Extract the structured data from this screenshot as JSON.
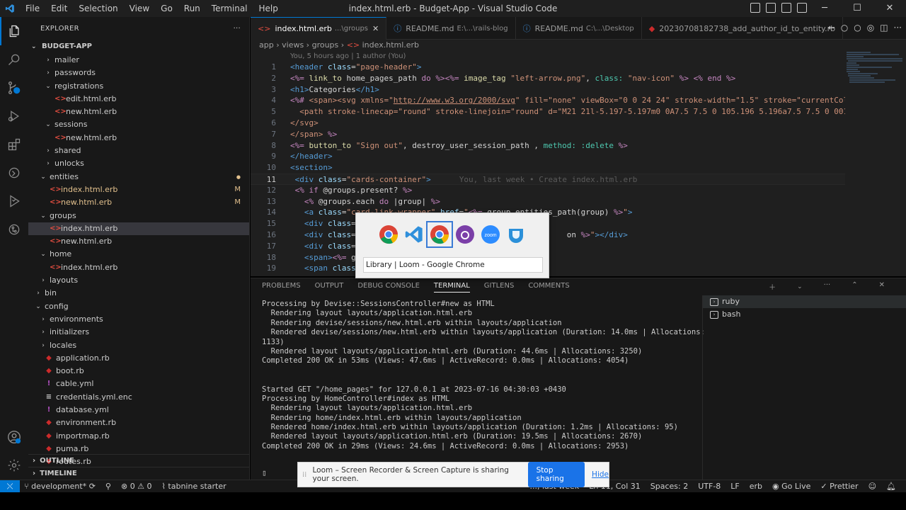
{
  "titlebar": {
    "menu": [
      "File",
      "Edit",
      "Selection",
      "View",
      "Go",
      "Run",
      "Terminal",
      "Help"
    ],
    "title": "index.html.erb - Budget-App - Visual Studio Code"
  },
  "activity_icons": [
    "files-icon",
    "search-icon",
    "source-control-icon",
    "run-debug-icon",
    "extensions-icon",
    "remote-icon",
    "testing-icon",
    "gitlens-icon"
  ],
  "sidebar": {
    "header": "EXPLORER",
    "more": "···",
    "project": "BUDGET-APP",
    "tree": [
      {
        "label": "mailer",
        "indent": 2,
        "type": "folder",
        "open": false
      },
      {
        "label": "passwords",
        "indent": 2,
        "type": "folder",
        "open": false
      },
      {
        "label": "registrations",
        "indent": 2,
        "type": "folder",
        "open": true
      },
      {
        "label": "edit.html.erb",
        "indent": 3,
        "type": "erb"
      },
      {
        "label": "new.html.erb",
        "indent": 3,
        "type": "erb"
      },
      {
        "label": "sessions",
        "indent": 2,
        "type": "folder",
        "open": true
      },
      {
        "label": "new.html.erb",
        "indent": 3,
        "type": "erb"
      },
      {
        "label": "shared",
        "indent": 2,
        "type": "folder",
        "open": false
      },
      {
        "label": "unlocks",
        "indent": 2,
        "type": "folder",
        "open": false
      },
      {
        "label": "entities",
        "indent": 1,
        "type": "folder",
        "open": true,
        "mod": "dot"
      },
      {
        "label": "index.html.erb",
        "indent": 2,
        "type": "erb",
        "mod": "M"
      },
      {
        "label": "new.html.erb",
        "indent": 2,
        "type": "erb",
        "mod": "M"
      },
      {
        "label": "groups",
        "indent": 1,
        "type": "folder",
        "open": true
      },
      {
        "label": "index.html.erb",
        "indent": 2,
        "type": "erb",
        "selected": true
      },
      {
        "label": "new.html.erb",
        "indent": 2,
        "type": "erb"
      },
      {
        "label": "home",
        "indent": 1,
        "type": "folder",
        "open": true
      },
      {
        "label": "index.html.erb",
        "indent": 2,
        "type": "erb"
      },
      {
        "label": "layouts",
        "indent": 1,
        "type": "folder",
        "open": false
      },
      {
        "label": "bin",
        "indent": 0,
        "type": "folder",
        "open": false
      },
      {
        "label": "config",
        "indent": 0,
        "type": "folder",
        "open": true
      },
      {
        "label": "environments",
        "indent": 1,
        "type": "folder",
        "open": false
      },
      {
        "label": "initializers",
        "indent": 1,
        "type": "folder",
        "open": false
      },
      {
        "label": "locales",
        "indent": 1,
        "type": "folder",
        "open": false
      },
      {
        "label": "application.rb",
        "indent": 1,
        "type": "rb"
      },
      {
        "label": "boot.rb",
        "indent": 1,
        "type": "rb"
      },
      {
        "label": "cable.yml",
        "indent": 1,
        "type": "yml"
      },
      {
        "label": "credentials.yml.enc",
        "indent": 1,
        "type": "enc"
      },
      {
        "label": "database.yml",
        "indent": 1,
        "type": "yml"
      },
      {
        "label": "environment.rb",
        "indent": 1,
        "type": "rb"
      },
      {
        "label": "importmap.rb",
        "indent": 1,
        "type": "rb"
      },
      {
        "label": "puma.rb",
        "indent": 1,
        "type": "rb"
      },
      {
        "label": "routes.rb",
        "indent": 1,
        "type": "rb"
      }
    ],
    "outline": "OUTLINE",
    "timeline": "TIMELINE"
  },
  "editor": {
    "tabs": [
      {
        "label": "index.html.erb",
        "desc": "...\\groups",
        "active": true,
        "icon": "<>"
      },
      {
        "label": "README.md",
        "desc": "E:\\...\\rails-blog",
        "icon": "ⓘ"
      },
      {
        "label": "README.md",
        "desc": "C:\\...\\Desktop",
        "icon": "ⓘ"
      },
      {
        "label": "20230708182738_add_author_id_to_entity.rb",
        "desc": "",
        "icon": "◆"
      }
    ],
    "breadcrumb": [
      "app",
      "views",
      "groups",
      "index.html.erb"
    ],
    "blame": "You, 5 hours ago | 1 author (You)",
    "inline_blame": "You, last week • Create index.html.erb",
    "current_line": 11
  },
  "panel": {
    "tabs": [
      "PROBLEMS",
      "OUTPUT",
      "DEBUG CONSOLE",
      "TERMINAL",
      "GITLENS",
      "COMMENTS"
    ],
    "active_tab": "TERMINAL",
    "terminal_lines": [
      "Processing by Devise::SessionsController#new as HTML",
      "  Rendering layout layouts/application.html.erb",
      "  Rendering devise/sessions/new.html.erb within layouts/application",
      "  Rendered devise/sessions/new.html.erb within layouts/application (Duration: 14.0ms | Allocations:",
      "1133)",
      "  Rendered layout layouts/application.html.erb (Duration: 44.6ms | Allocations: 3250)",
      "Completed 200 OK in 53ms (Views: 47.6ms | ActiveRecord: 0.0ms | Allocations: 4054)",
      "",
      "",
      "Started GET \"/home_pages\" for 127.0.0.1 at 2023-07-16 04:30:03 +0430",
      "Processing by HomeController#index as HTML",
      "  Rendering layout layouts/application.html.erb",
      "  Rendering home/index.html.erb within layouts/application",
      "  Rendered home/index.html.erb within layouts/application (Duration: 1.2ms | Allocations: 95)",
      "  Rendered layout layouts/application.html.erb (Duration: 19.5ms | Allocations: 2670)",
      "Completed 200 OK in 29ms (Views: 24.6ms | ActiveRecord: 0.0ms | Allocations: 2953)"
    ],
    "terminals": [
      "ruby",
      "bash"
    ]
  },
  "statusbar": {
    "branch": "development*",
    "problems": "0",
    "warnings": "0",
    "tabnine": "tabnine starter",
    "blame": "..., last week",
    "position": "Ln 11, Col 31",
    "spaces": "Spaces: 2",
    "encoding": "UTF-8",
    "eol": "LF",
    "language": "erb",
    "golive": "Go Live",
    "prettier": "Prettier"
  },
  "switcher": {
    "apps": [
      "chrome",
      "vscode",
      "chrome",
      "github-desktop",
      "zoom",
      "edge"
    ],
    "selected_index": 2,
    "label": "Library | Loom - Google Chrome"
  },
  "loom": {
    "message": "Loom – Screen Recorder & Screen Capture is sharing your screen.",
    "stop": "Stop sharing",
    "hide": "Hide"
  },
  "colors": {
    "accent": "#0078d4",
    "loom_blue": "#1a73e8"
  }
}
